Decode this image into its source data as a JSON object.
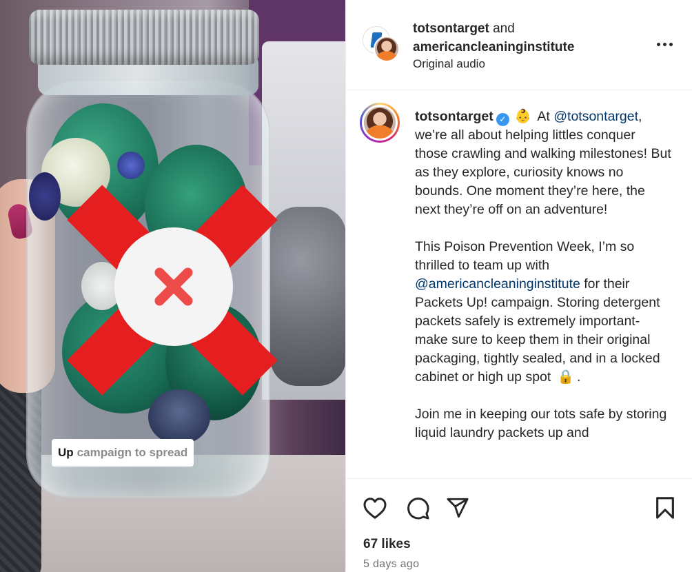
{
  "post": {
    "media_caption": {
      "strong": "Up",
      "rest": "campaign to spread"
    },
    "header": {
      "user1": "totsontarget",
      "and": "and",
      "user2": "americancleaninginstitute",
      "audio": "Original audio"
    },
    "caption": {
      "username": "totsontarget",
      "p1_before": "At",
      "p1_mention": "@totsontarget",
      "p1_after": ", we’re all about helping littles conquer those crawling and walking milestones! But as they explore, curiosity knows no bounds. One moment they’re here, the next they’re off on an adventure!",
      "p2_before": "This Poison Prevention Week, I’m so thrilled to team up with",
      "p2_mention": "@americancleaninginstitute",
      "p2_after": "for their Packets Up! campaign. Storing detergent packets safely is extremely important- make sure to keep them in their original packaging, tightly sealed, and in a locked cabinet or high up spot",
      "p2_end": ".",
      "p3": "Join me in keeping our tots safe by storing liquid laundry packets up and"
    },
    "emoji_baby": "👶",
    "emoji_lock": "🔒",
    "likes": "67 likes",
    "date": "5 days ago"
  },
  "icons": {
    "more": "more-options-icon",
    "like": "heart-icon",
    "comment": "comment-icon",
    "share": "share-icon",
    "save": "bookmark-icon",
    "verified": "verified-badge-icon"
  },
  "colors": {
    "mention": "#00376b",
    "verified": "#3897f0",
    "x_red": "#e51f1f"
  }
}
